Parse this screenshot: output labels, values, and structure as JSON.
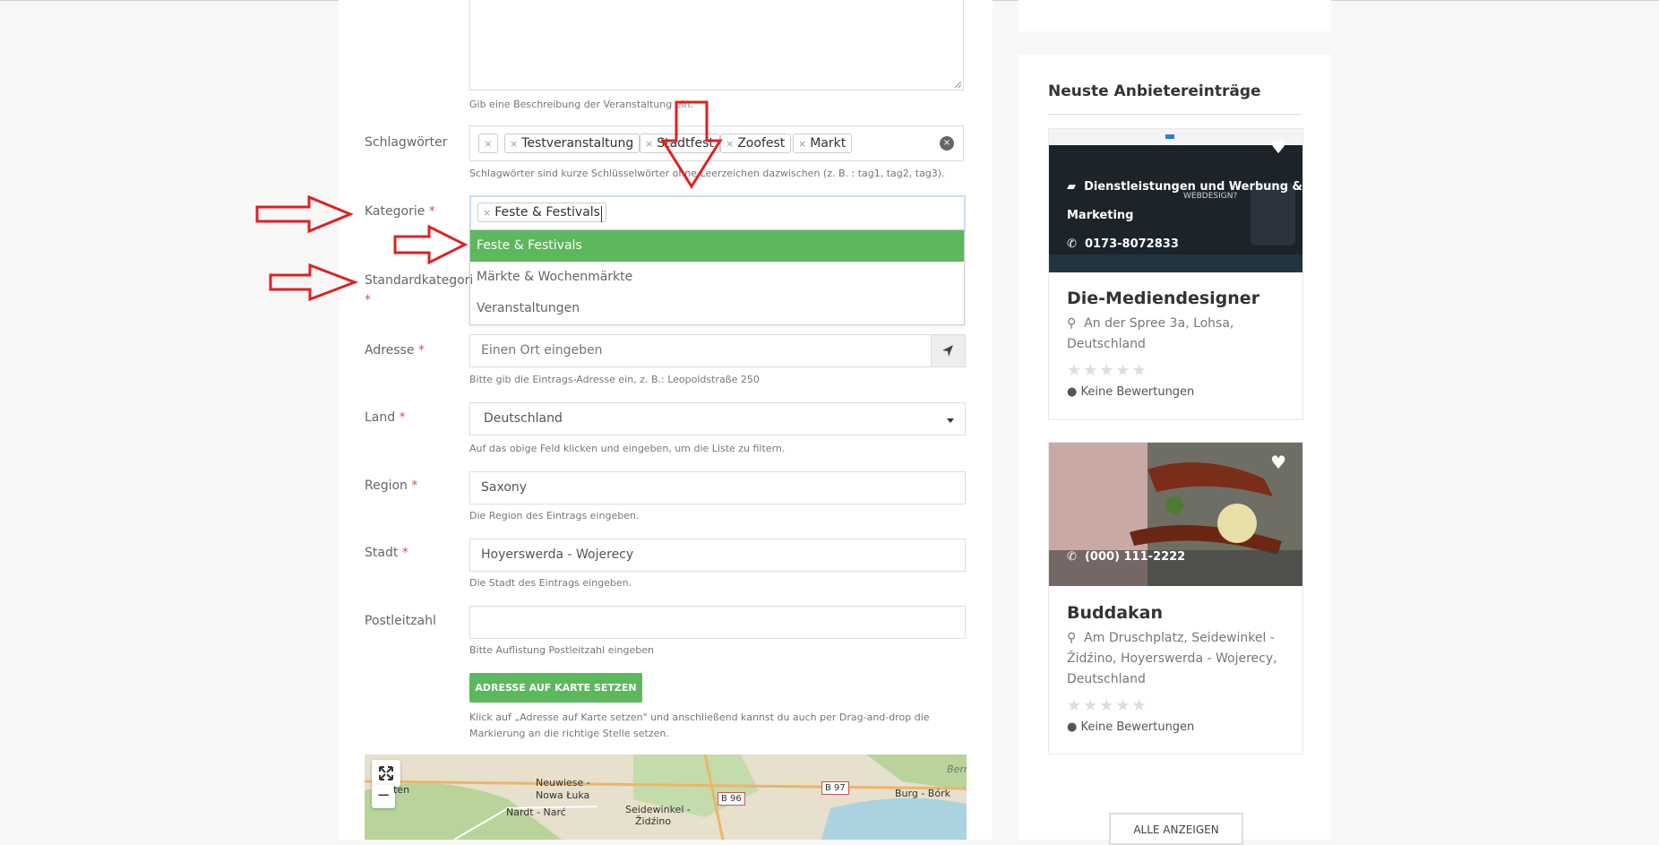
{
  "form": {
    "description_help": "Gib eine Beschreibung der Veranstaltung ein.",
    "keywords": {
      "label": "Schlagwörter",
      "tags": [
        "Testveranstaltung",
        "Stadtfest",
        "Zoofest",
        "Markt"
      ],
      "help": "Schlagwörter sind kurze Schlüsselwörter ohne Leerzeichen dazwischen (z. B. : tag1, tag2, tag3).",
      "remove_glyph": "×",
      "clear_glyph": "×"
    },
    "category": {
      "label": "Kategorie",
      "required": "*",
      "selected_tag": "Feste & Festivals",
      "options": [
        "Feste & Festivals",
        "Märkte & Wochenmärkte",
        "Veranstaltungen"
      ],
      "active_index": 0
    },
    "default_category": {
      "label": "Standardkategorie",
      "required": "*"
    },
    "address": {
      "label": "Adresse",
      "required": "*",
      "placeholder": "Einen Ort eingeben",
      "help": "Bitte gib die Eintrags-Adresse ein, z. B.: Leopoldstraße 250"
    },
    "country": {
      "label": "Land",
      "required": "*",
      "value": "Deutschland",
      "help": "Auf das obige Feld klicken und eingeben, um die Liste zu filtern."
    },
    "region": {
      "label": "Region",
      "required": "*",
      "value": "Saxony",
      "help": "Die Region des Eintrags eingeben."
    },
    "city": {
      "label": "Stadt",
      "required": "*",
      "value": "Hoyerswerda - Wojerecy",
      "help": "Die Stadt des Eintrags eingeben."
    },
    "postal": {
      "label": "Postleitzahl",
      "value": "",
      "help": "Bitte Auflistung Postleitzahl eingeben"
    },
    "set_address_button": "ADRESSE AUF KARTE SETZEN",
    "map_help": "Klick auf „Adresse auf Karte setzen\" und anschließend kannst du auch per Drag-and-drop die Markierung an die richtige Stelle setzen.",
    "map": {
      "zoom_out": "−",
      "labels": [
        "Neuwiese -",
        "Nowa Łuka",
        "Nardt - Narć",
        "Seidewinkel -",
        "Židźino",
        "Burg - Bórk",
        "Bern",
        "ten"
      ],
      "roads": [
        "B 96",
        "B 97"
      ]
    }
  },
  "sidebar": {
    "title": "Neuste Anbietereinträge",
    "cards": [
      {
        "name": "Die-Mediendesigner",
        "category": "Dienstleistungen und Werbung &",
        "category_line2": "Marketing",
        "phone": "0173-8072833",
        "address_line1": "An der Spree 3a, Lohsa,",
        "address_line2": "Deutschland",
        "reviews": "Keine Bewertungen",
        "image_text": "WEBDESIGN?"
      },
      {
        "name": "Buddakan",
        "phone": "(000) 111-2222",
        "address_line1": "Am Druschplatz, Seidewinkel -",
        "address_line2": "Židźino, Hoyerswerda - Wojerecy,",
        "address_line3": "Deutschland",
        "reviews": "Keine Bewertungen"
      }
    ],
    "stars": "★★★★★",
    "all_button": "ALLE ANZEIGEN"
  },
  "colors": {
    "accent_green": "#5cb85c",
    "required_red": "#d9534f",
    "annotation_red": "#e02020"
  }
}
